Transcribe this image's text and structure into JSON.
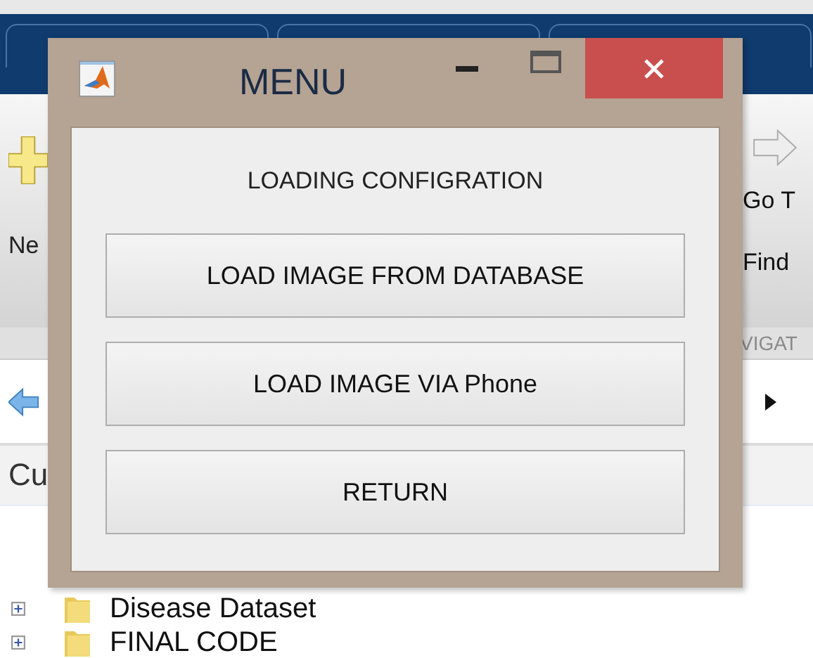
{
  "background": {
    "toolbar_left_label": "Ne",
    "toolbar_right_labels": [
      "Go T",
      "Find"
    ],
    "section_label": "VIGAT",
    "folder_header": "Cu",
    "files": [
      {
        "name": "Disease Dataset",
        "expanded": false
      },
      {
        "name": "FINAL CODE",
        "expanded": false
      }
    ]
  },
  "dialog": {
    "title": "MENU",
    "heading": "LOADING CONFIGRATION",
    "buttons": [
      {
        "label": "LOAD IMAGE FROM DATABASE"
      },
      {
        "label": "LOAD IMAGE VIA Phone"
      },
      {
        "label": "RETURN"
      }
    ]
  }
}
